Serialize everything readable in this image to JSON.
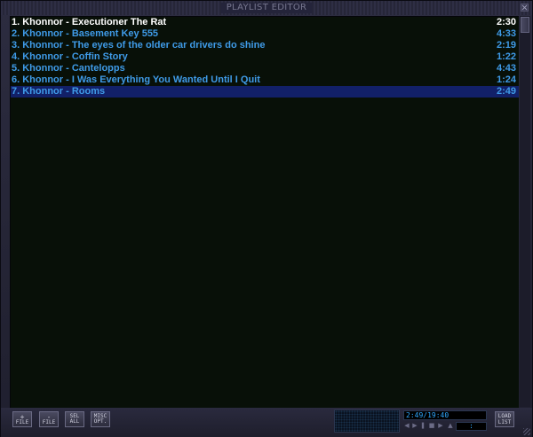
{
  "window": {
    "title": "PLAYLIST EDITOR"
  },
  "playlist": {
    "tracks": [
      {
        "label": "1. Khonnor - Executioner The Rat",
        "length": "2:30",
        "state": "current"
      },
      {
        "label": "2. Khonnor - Basement Key 555",
        "length": "4:33",
        "state": "normal"
      },
      {
        "label": "3. Khonnor - The eyes of the older car drivers do shine",
        "length": "2:19",
        "state": "normal"
      },
      {
        "label": "4. Khonnor - Coffin Story",
        "length": "1:22",
        "state": "normal"
      },
      {
        "label": "5. Khonnor - Cantelopps",
        "length": "4:43",
        "state": "normal"
      },
      {
        "label": "6. Khonnor - I Was Everything You Wanted Until I Quit",
        "length": "1:24",
        "state": "normal"
      },
      {
        "label": "7. Khonnor - Rooms",
        "length": "2:49",
        "state": "selected"
      }
    ]
  },
  "bottombar": {
    "buttons": [
      {
        "symbol": "+",
        "label": "FILE"
      },
      {
        "symbol": "-",
        "label": "FILE"
      },
      {
        "symbol": "SEL",
        "label": "ALL"
      },
      {
        "symbol": "MISC",
        "label": "OPT."
      }
    ],
    "time_display": "2:49/19:40",
    "mini_time": ":",
    "load_list": {
      "line1": "LOAD",
      "line2": "LIST"
    },
    "mini_controls": [
      "prev-icon",
      "play-icon",
      "pause-icon",
      "stop-icon",
      "next-icon",
      "eject-icon"
    ]
  },
  "colors": {
    "track_text": "#3f9be8",
    "current_track_text": "#ffffff",
    "selected_bg": "#122068",
    "list_bg": "#081008",
    "time_text": "#2fa8ff"
  }
}
